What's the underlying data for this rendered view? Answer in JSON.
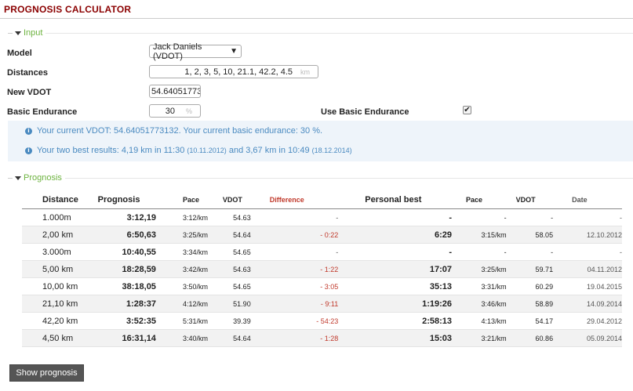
{
  "title": "PROGNOSIS CALCULATOR",
  "sections": {
    "input": "Input",
    "prognosis": "Prognosis"
  },
  "form": {
    "model_label": "Model",
    "model_value": "Jack Daniels (VDOT)",
    "distances_label": "Distances",
    "distances_value": "1, 2, 3, 5, 10, 21.1, 42.2, 4.5",
    "distances_unit": "km",
    "new_vdot_label": "New VDOT",
    "new_vdot_value": "54.64051773:",
    "basic_endurance_label": "Basic Endurance",
    "basic_endurance_value": "30",
    "basic_endurance_unit": "%",
    "use_basic_endurance_label": "Use Basic Endurance",
    "use_basic_endurance_checked": true
  },
  "info": {
    "line1": "Your current VDOT: 54.64051773132. Your current basic endurance: 30 %.",
    "line2_a": "Your two best results: 4,19 km in 11:30",
    "line2_b": "(10.11.2012)",
    "line2_c": "and 3,67 km in 10:49",
    "line2_d": "(18.12.2014)"
  },
  "table": {
    "headers": {
      "distance": "Distance",
      "prognosis": "Prognosis",
      "pace": "Pace",
      "vdot": "VDOT",
      "difference": "Difference",
      "personal_best": "Personal best",
      "pb_pace": "Pace",
      "pb_vdot": "VDOT",
      "date": "Date"
    },
    "rows": [
      {
        "distance": "1.000m",
        "prognosis": "3:12,19",
        "pace": "3:12/km",
        "vdot": "54.63",
        "difference": "-",
        "pb": "-",
        "pb_pace": "-",
        "pb_vdot": "-",
        "date": "-"
      },
      {
        "distance": "2,00 km",
        "prognosis": "6:50,63",
        "pace": "3:25/km",
        "vdot": "54.64",
        "difference": "- 0:22",
        "pb": "6:29",
        "pb_pace": "3:15/km",
        "pb_vdot": "58.05",
        "date": "12.10.2012"
      },
      {
        "distance": "3.000m",
        "prognosis": "10:40,55",
        "pace": "3:34/km",
        "vdot": "54.65",
        "difference": "-",
        "pb": "-",
        "pb_pace": "-",
        "pb_vdot": "-",
        "date": "-"
      },
      {
        "distance": "5,00 km",
        "prognosis": "18:28,59",
        "pace": "3:42/km",
        "vdot": "54.63",
        "difference": "- 1:22",
        "pb": "17:07",
        "pb_pace": "3:25/km",
        "pb_vdot": "59.71",
        "date": "04.11.2012"
      },
      {
        "distance": "10,00 km",
        "prognosis": "38:18,05",
        "pace": "3:50/km",
        "vdot": "54.65",
        "difference": "- 3:05",
        "pb": "35:13",
        "pb_pace": "3:31/km",
        "pb_vdot": "60.29",
        "date": "19.04.2015"
      },
      {
        "distance": "21,10 km",
        "prognosis": "1:28:37",
        "pace": "4:12/km",
        "vdot": "51.90",
        "difference": "- 9:11",
        "pb": "1:19:26",
        "pb_pace": "3:46/km",
        "pb_vdot": "58.89",
        "date": "14.09.2014"
      },
      {
        "distance": "42,20 km",
        "prognosis": "3:52:35",
        "pace": "5:31/km",
        "vdot": "39.39",
        "difference": "- 54:23",
        "pb": "2:58:13",
        "pb_pace": "4:13/km",
        "pb_vdot": "54.17",
        "date": "29.04.2012"
      },
      {
        "distance": "4,50 km",
        "prognosis": "16:31,14",
        "pace": "3:40/km",
        "vdot": "54.64",
        "difference": "- 1:28",
        "pb": "15:03",
        "pb_pace": "3:21/km",
        "pb_vdot": "60.86",
        "date": "05.09.2014"
      }
    ]
  },
  "show_button": "Show prognosis",
  "colors": {
    "title": "#8b0000",
    "legend": "#6db33f",
    "info": "#4a8ac0",
    "negative": "#c0392b"
  }
}
